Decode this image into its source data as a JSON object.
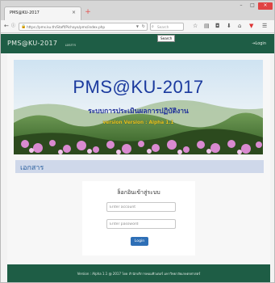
{
  "browser": {
    "tab_title": "PMS@KU-2017",
    "tab_close": "×",
    "new_tab": "+",
    "url": "https://pms.ku.th/Staff/Pichaya/pms/index.php",
    "search_placeholder": "Search",
    "tooltip": "Search",
    "window_controls": {
      "minimize": "–",
      "maximize": "□",
      "close": "×"
    }
  },
  "site_header": {
    "brand": "PMS@KU-2017",
    "nav_link": "เอกสาร",
    "login": "Login"
  },
  "banner": {
    "title": "PMS@KU-2017",
    "subtitle": "ระบบการประเมินผลการปฏิบัติงาน",
    "version": "version Version : Alpha 1.1"
  },
  "section": {
    "title": "เอกสาร"
  },
  "login": {
    "heading": "ล็อกอินเข้าสู่ระบบ",
    "account_placeholder": "Enter account",
    "password_placeholder": "Enter password",
    "button": "Login"
  },
  "footer": {
    "text": "Version : Alpha 1.1 @ 2017 โดย สำนักบริการคอมพิวเตอร์ มหาวิทยาลัยเกษตรศาสตร์"
  },
  "colors": {
    "header_green": "#1e5d45",
    "banner_title_blue": "#1b3a9e",
    "version_yellow": "#e8c81c",
    "section_bg": "#cfd8ea",
    "section_text": "#2a5f9e",
    "button_blue": "#2e6fb6"
  }
}
